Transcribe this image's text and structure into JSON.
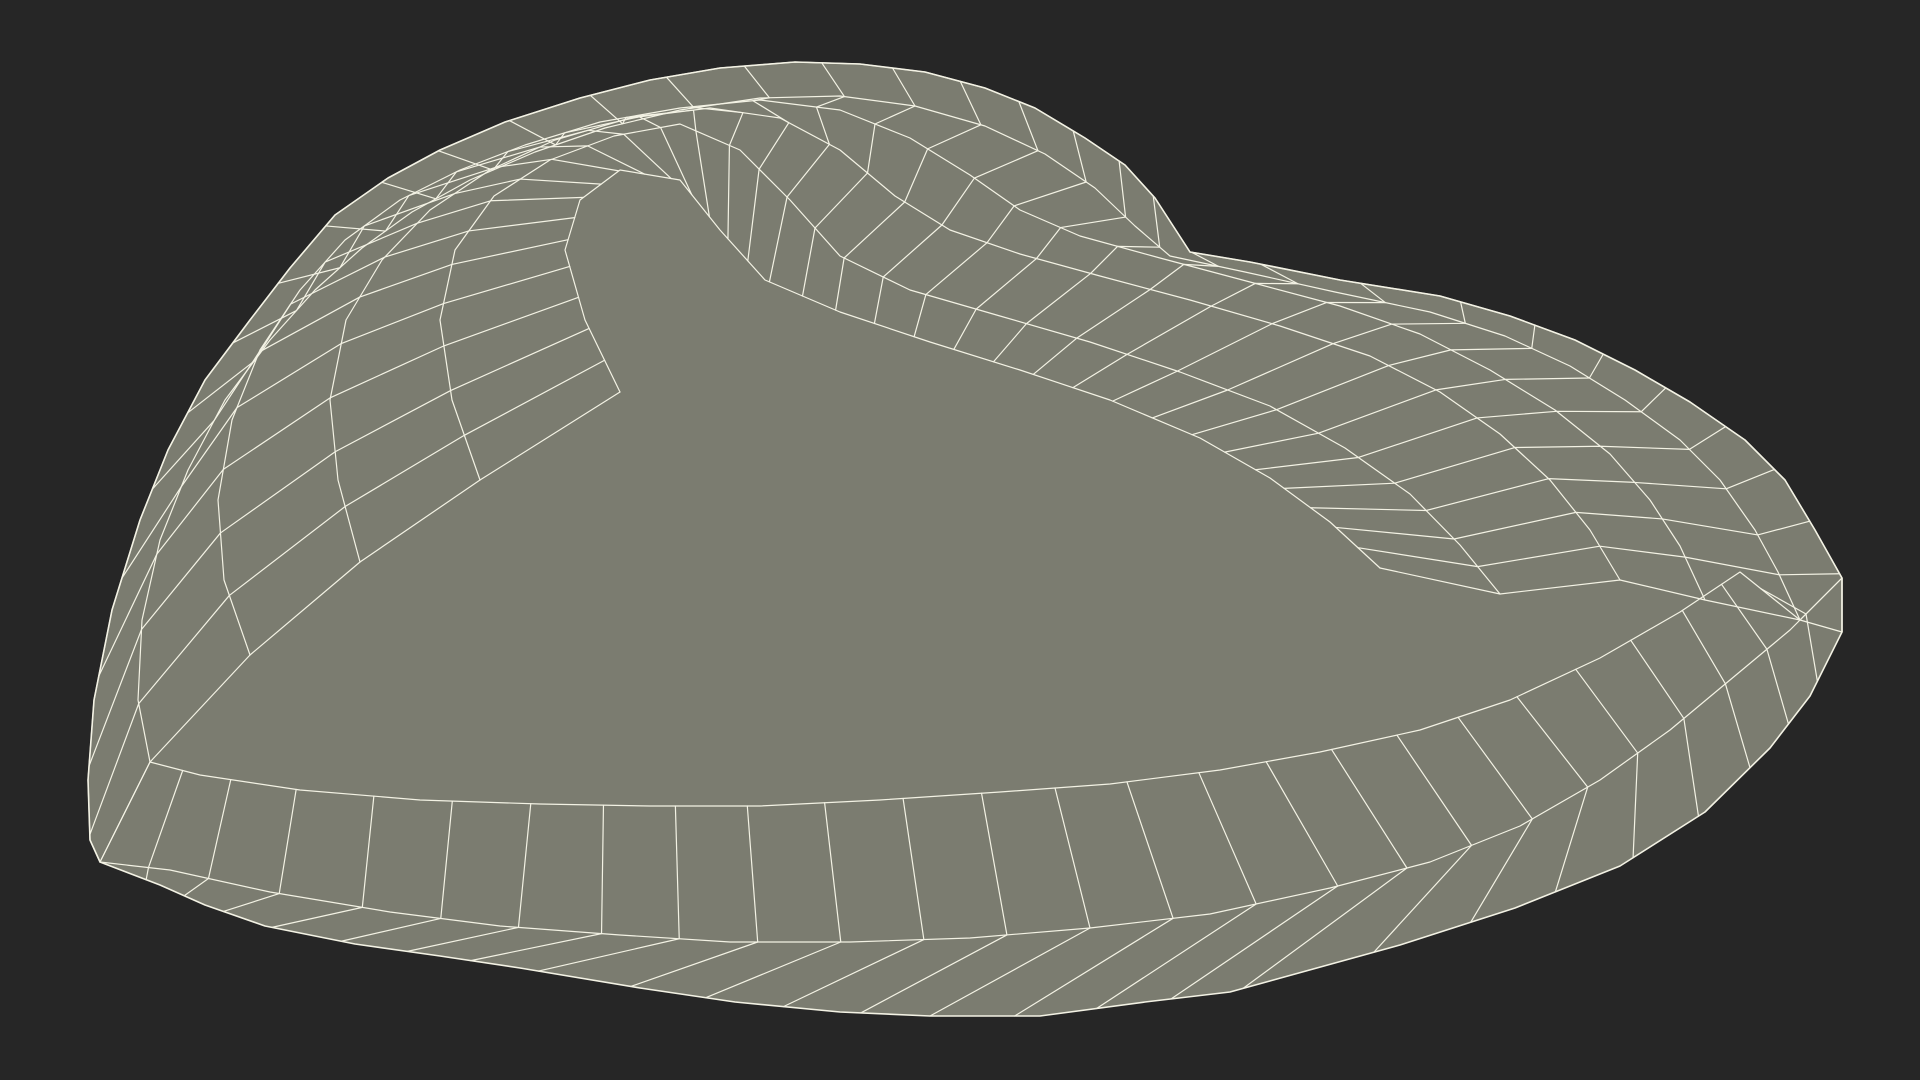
{
  "scene": {
    "subject": "heart-shaped-wireframe-mesh",
    "colors": {
      "background": "#262626",
      "surface": "#7b7c70",
      "wire": "#f3f2e4"
    }
  }
}
